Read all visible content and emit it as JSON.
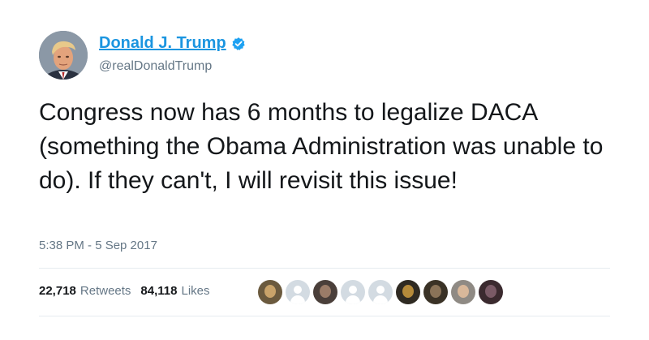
{
  "user": {
    "display_name": "Donald J. Trump",
    "handle": "@realDonaldTrump",
    "verified": true,
    "verified_icon": "verified-badge-icon"
  },
  "tweet": {
    "text": "Congress now has 6 months to legalize DACA (something the Obama Administration was unable to do). If they can't, I will revisit this issue!",
    "timestamp": "5:38 PM - 5 Sep 2017"
  },
  "stats": {
    "retweets_count": "22,718",
    "retweets_label": "Retweets",
    "likes_count": "84,118",
    "likes_label": "Likes"
  },
  "likers": [
    {
      "style": "photo",
      "color": "#6b5a3e",
      "accent": "#c9a36a"
    },
    {
      "style": "default"
    },
    {
      "style": "photo",
      "color": "#4a3f3a",
      "accent": "#9b7c68"
    },
    {
      "style": "default"
    },
    {
      "style": "default"
    },
    {
      "style": "photo",
      "color": "#2f2a22",
      "accent": "#b58a3a"
    },
    {
      "style": "photo",
      "color": "#3a3226",
      "accent": "#8a7358"
    },
    {
      "style": "photo",
      "color": "#8f8a84",
      "accent": "#d9b89a"
    },
    {
      "style": "photo",
      "color": "#3b2a2f",
      "accent": "#7a5a66"
    }
  ],
  "colors": {
    "link": "#1b95e0",
    "secondary_text": "#657786",
    "primary_text": "#14171a",
    "divider": "#e6ecf0"
  }
}
